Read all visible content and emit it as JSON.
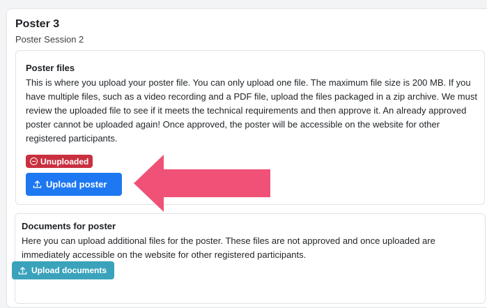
{
  "poster": {
    "title": "Poster 3",
    "session": "Poster Session 2"
  },
  "poster_files": {
    "heading": "Poster files",
    "description": "This is where you upload your poster file. You can only upload one file. The maximum file size is 200 MB. If you have multiple files, such as a video recording and a PDF file, upload the files packaged in a zip archive. We must review the uploaded file to see if it meets the technical requirements and then approve it. An already approved poster cannot be uploaded again! Once approved, the poster will be accessible on the website for other registered participants.",
    "status_badge": "Unuploaded",
    "status_icon": "minus-circle-icon",
    "status_color": "#c9303f",
    "upload_button": "Upload poster",
    "upload_icon": "upload-icon",
    "button_color": "#1d78f2"
  },
  "documents": {
    "heading": "Documents for poster",
    "description": "Here you can upload additional files for the poster. These files are not approved and once uploaded are immediately accessible on the website for other registered participants.",
    "upload_button": "Upload documents",
    "upload_icon": "upload-icon",
    "button_color": "#3aa3bb"
  },
  "annotation": {
    "arrow_color": "#ef5276",
    "arrow_icon": "left-arrow-annotation"
  }
}
